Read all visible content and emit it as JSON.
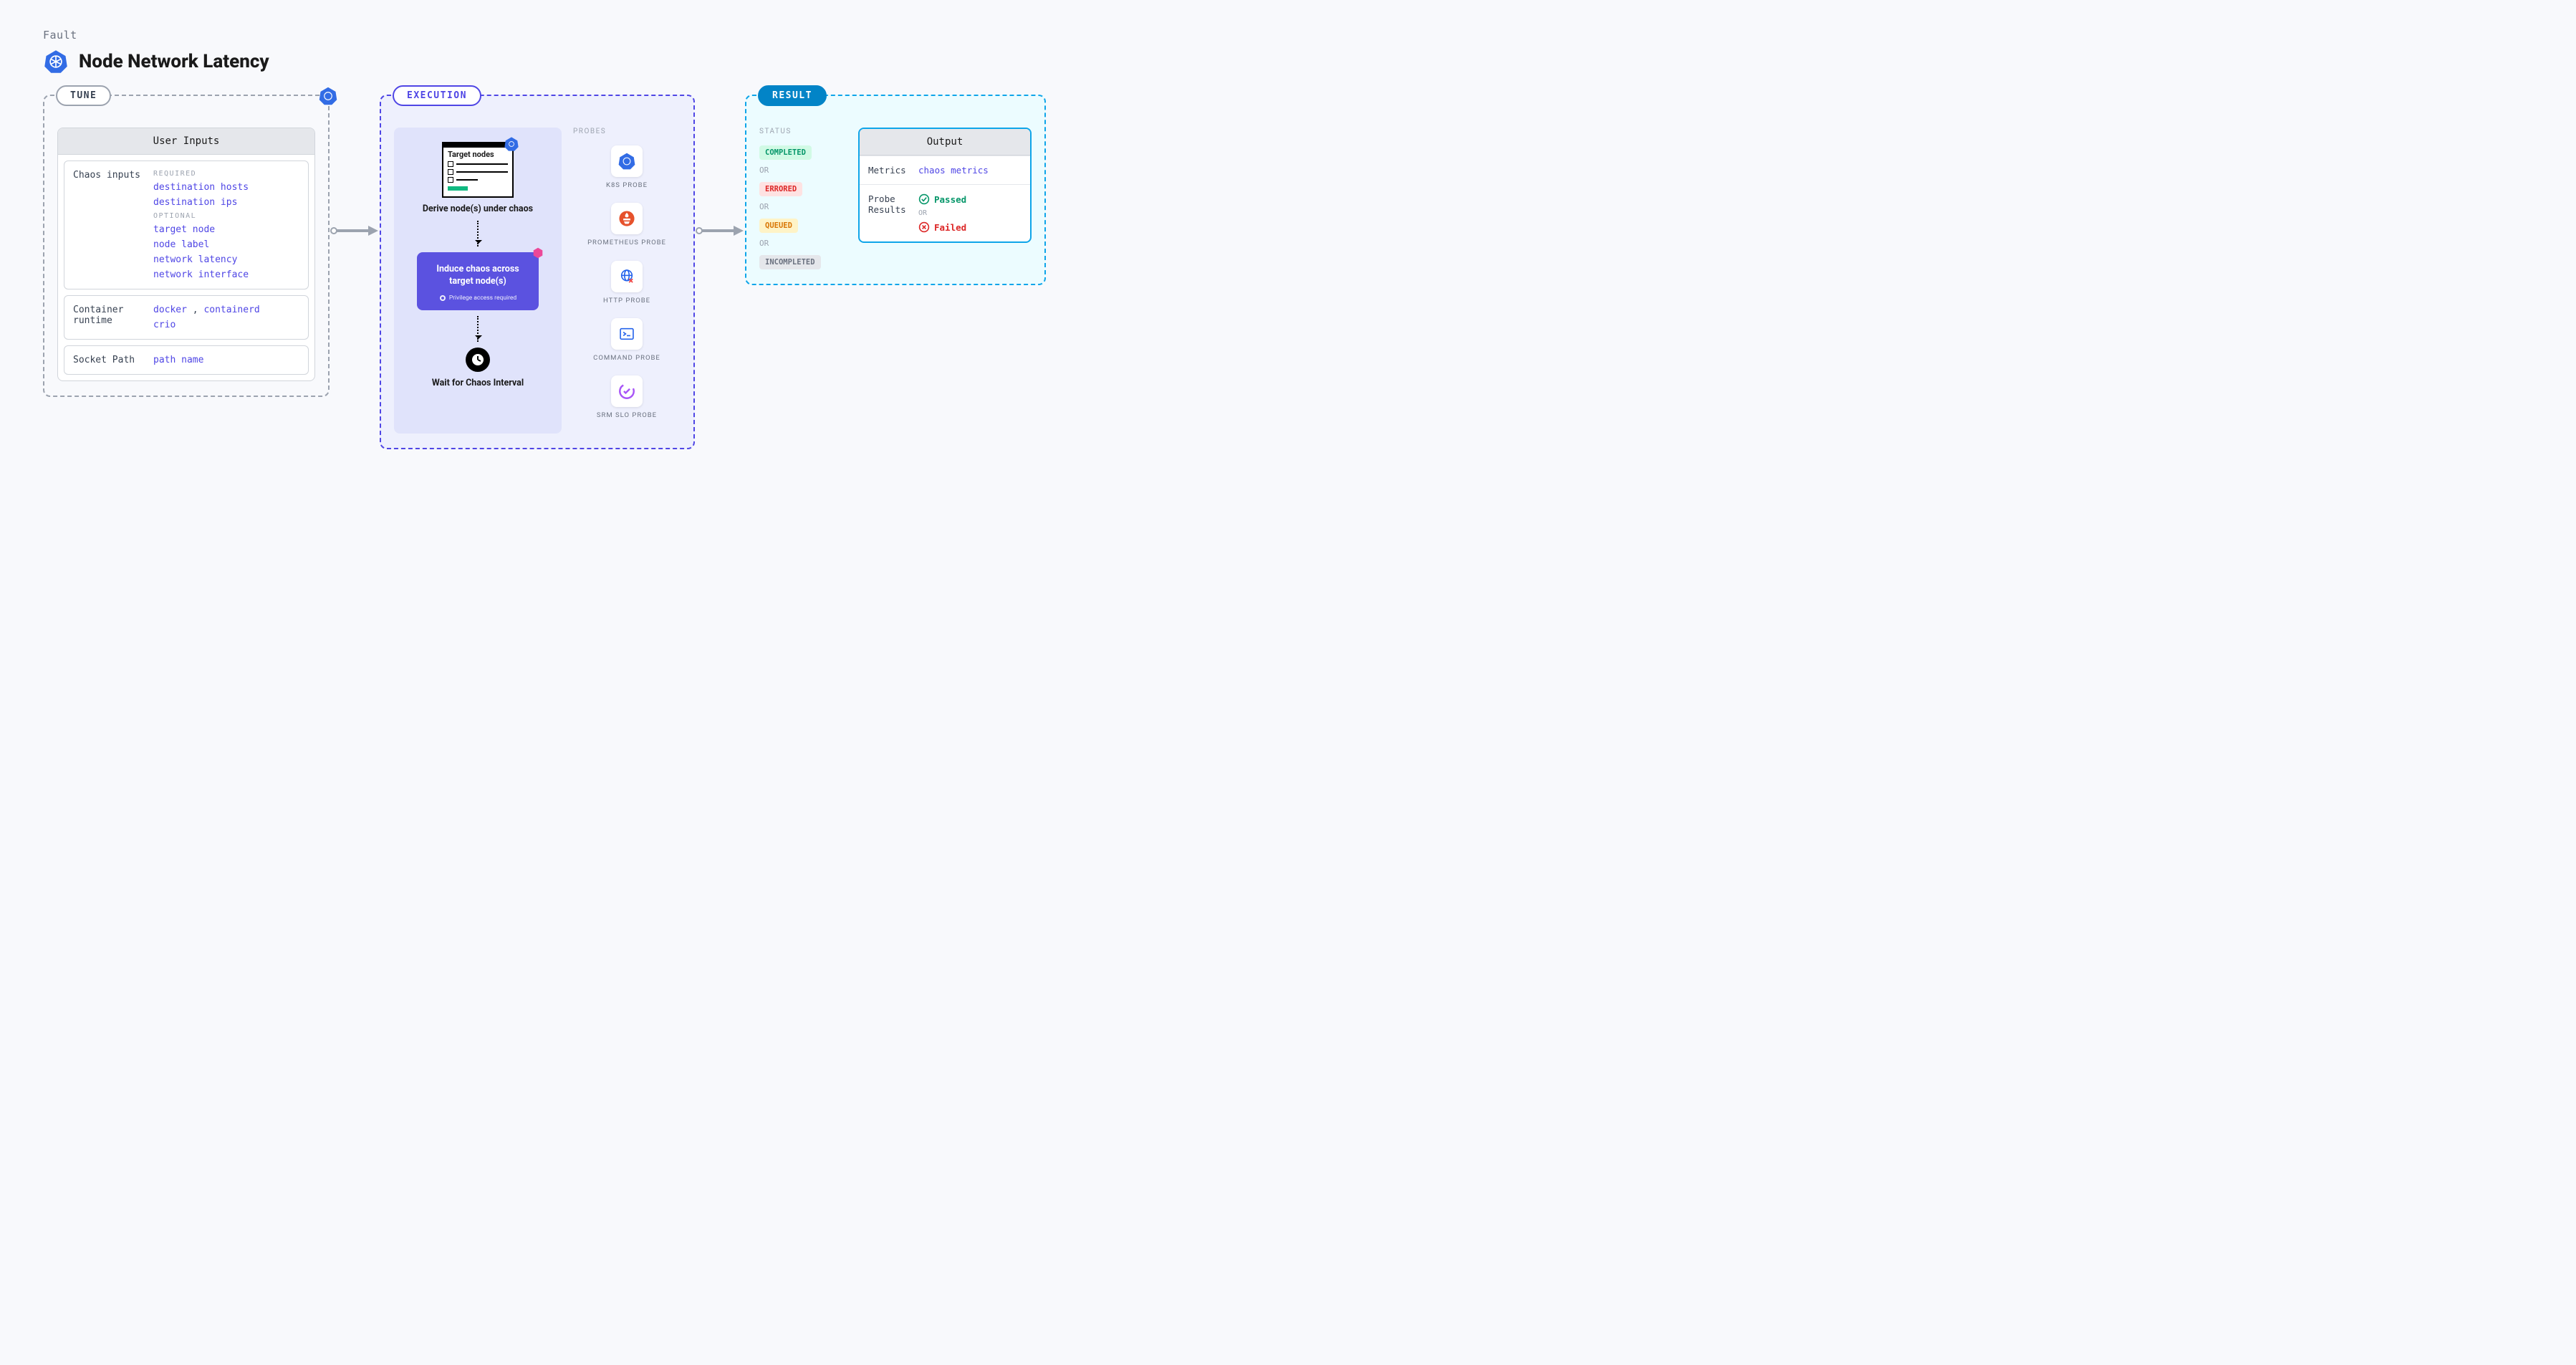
{
  "header": {
    "breadcrumb": "Fault",
    "title": "Node Network Latency"
  },
  "tune": {
    "label": "TUNE",
    "panel_title": "User Inputs",
    "chaos_inputs": {
      "label": "Chaos inputs",
      "required_head": "REQUIRED",
      "required": [
        "destination hosts",
        "destination ips"
      ],
      "optional_head": "OPTIONAL",
      "optional": [
        "target node",
        "node label",
        "network latency",
        "network interface"
      ]
    },
    "container_runtime": {
      "label": "Container runtime",
      "values": [
        "docker",
        "containerd",
        "crio"
      ]
    },
    "socket_path": {
      "label": "Socket Path",
      "value": "path name"
    }
  },
  "execution": {
    "label": "EXECUTION",
    "target_card_title": "Target nodes",
    "derive_step": "Derive node(s) under chaos",
    "induce_step": "Induce chaos across target node(s)",
    "privilege_note": "Privilege access required",
    "wait_step": "Wait for Chaos Interval",
    "probes_head": "PROBES",
    "probes": [
      {
        "name": "k8s",
        "label": "K8S PROBE"
      },
      {
        "name": "prometheus",
        "label": "PROMETHEUS PROBE"
      },
      {
        "name": "http",
        "label": "HTTP PROBE"
      },
      {
        "name": "command",
        "label": "COMMAND PROBE"
      },
      {
        "name": "srm",
        "label": "SRM SLO PROBE"
      }
    ]
  },
  "result": {
    "label": "RESULT",
    "status_head": "STATUS",
    "statuses": [
      "COMPLETED",
      "ERRORED",
      "QUEUED",
      "INCOMPLETED"
    ],
    "or": "OR",
    "output_title": "Output",
    "metrics_label": "Metrics",
    "metrics_value": "chaos metrics",
    "probe_results_label": "Probe Results",
    "passed": "Passed",
    "failed": "Failed"
  }
}
